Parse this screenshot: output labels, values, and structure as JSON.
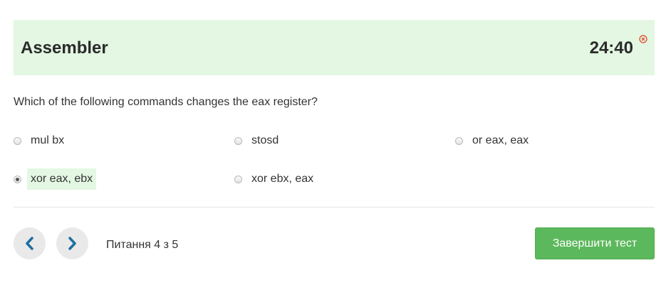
{
  "header": {
    "title": "Assembler",
    "timer": "24:40",
    "close_icon": "close-circle-icon",
    "close_icon_color": "#e05a3a",
    "background": "#e3f7e3"
  },
  "question": {
    "text": "Which of the following commands changes the eax register?"
  },
  "options": [
    {
      "label": "mul bx",
      "checked": false
    },
    {
      "label": "stosd",
      "checked": false
    },
    {
      "label": "or eax, eax",
      "checked": false
    },
    {
      "label": "xor eax, ebx",
      "checked": true
    },
    {
      "label": "xor ebx, eax",
      "checked": false
    }
  ],
  "navigation": {
    "prev_icon": "chevron-left-icon",
    "next_icon": "chevron-right-icon",
    "icon_color": "#1e6f9f",
    "progress_text": "Питання 4 з 5",
    "current_question": 4,
    "total_questions": 5,
    "finish_label": "Завершити тест",
    "finish_color": "#5cb85c"
  }
}
